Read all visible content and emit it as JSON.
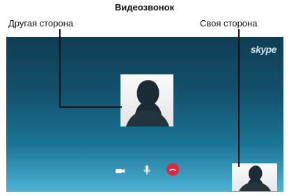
{
  "header": {
    "title": "Видеозвонок"
  },
  "labels": {
    "other_side": "Другая сторона",
    "own_side": "Своя сторона"
  },
  "call_screen": {
    "logo_text": "skype",
    "controls": [
      {
        "name": "video",
        "icon": "video-camera-icon"
      },
      {
        "name": "microphone",
        "icon": "microphone-icon"
      },
      {
        "name": "end-call",
        "icon": "end-call-icon",
        "color": "#e0283c"
      }
    ]
  },
  "colors": {
    "screen_top": "#0f3e54",
    "screen_bottom": "#4fb3d6",
    "end_call": "#e0283c"
  }
}
